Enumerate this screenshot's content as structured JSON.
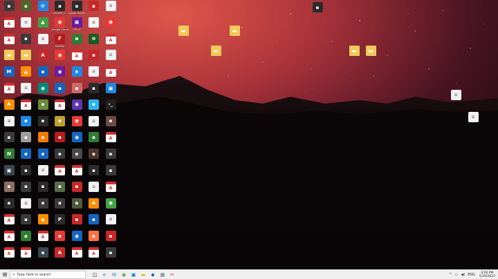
{
  "taskbar": {
    "search_placeholder": "Type here to search",
    "time": "4:00 PM",
    "date": "5/29/2023",
    "apps": [
      {
        "name": "task-view",
        "glyph": "◫",
        "color": "#333333"
      },
      {
        "name": "edge",
        "glyph": "e",
        "color": "#1e88e5"
      },
      {
        "name": "mail",
        "glyph": "✉",
        "color": "#0078d4"
      },
      {
        "name": "chrome",
        "glyph": "◉",
        "color": "#43a047"
      },
      {
        "name": "store",
        "glyph": "▣",
        "color": "#0078d4"
      },
      {
        "name": "file-explorer",
        "glyph": "▬",
        "color": "#e6b422"
      },
      {
        "name": "outlook",
        "glyph": "◆",
        "color": "#0064b4"
      },
      {
        "name": "photos",
        "glyph": "▦",
        "color": "#5a6b8a"
      },
      {
        "name": "snip",
        "glyph": "✂",
        "color": "#c62828"
      }
    ],
    "tray": [
      "^",
      "▭",
      "◀)",
      "ENG"
    ]
  },
  "desktop_icons": [
    {
      "label": "",
      "color": "#3a3a3a",
      "glyph": "▪"
    },
    {
      "label": "",
      "color": "#4a6a2a",
      "glyph": "▪"
    },
    {
      "label": "",
      "color": "#1e88e5",
      "glyph": "⟳"
    },
    {
      "label": "ureplaib_C...",
      "color": "#2b2b2b",
      "glyph": "▪"
    },
    {
      "label": "Adobe Notepad...",
      "color": "#2b2b2b",
      "glyph": "▪"
    },
    {
      "label": "...",
      "color": "#c62828",
      "glyph": "▪"
    },
    {
      "label": "",
      "color": "#ffffff",
      "glyph": "≡",
      "kind": "doc"
    },
    {
      "label": "",
      "color": "#ffffff",
      "glyph": "A",
      "kind": "pdf"
    },
    {
      "label": "",
      "color": "#ffffff",
      "glyph": "≡",
      "kind": "doc"
    },
    {
      "label": "",
      "color": "#43a047",
      "glyph": "▲"
    },
    {
      "label": "Google Chrome",
      "color": "#e53935",
      "glyph": "◉"
    },
    {
      "label": "CPU-Z",
      "color": "#6a1b9a",
      "glyph": "▣"
    },
    {
      "label": "",
      "color": "#ffffff",
      "glyph": "≡",
      "kind": "doc"
    },
    {
      "label": "",
      "color": "#e53935",
      "glyph": "◉"
    },
    {
      "label": "",
      "color": "#ffffff",
      "glyph": "A",
      "kind": "pdf"
    },
    {
      "label": "",
      "color": "#3a3a3a",
      "glyph": "▪"
    },
    {
      "label": "",
      "color": "#ffffff",
      "glyph": "≡",
      "kind": "doc"
    },
    {
      "label": "FileZilla",
      "color": "#b71c1c",
      "glyph": "F"
    },
    {
      "label": "",
      "color": "#2e7d32",
      "glyph": "▪"
    },
    {
      "label": "",
      "color": "#1b5e20",
      "glyph": "⊗"
    },
    {
      "label": "",
      "color": "#ffffff",
      "glyph": "A",
      "kind": "pdf"
    },
    {
      "label": "",
      "color": "#e0a030",
      "glyph": "▬",
      "kind": "folder"
    },
    {
      "label": "",
      "color": "#e0a030",
      "glyph": "▬",
      "kind": "folder"
    },
    {
      "label": "",
      "color": "#c62828",
      "glyph": "A"
    },
    {
      "label": "",
      "color": "#e53935",
      "glyph": "◉"
    },
    {
      "label": "",
      "color": "#ffffff",
      "glyph": "A",
      "kind": "pdf"
    },
    {
      "label": "",
      "color": "#c62828",
      "glyph": "▪"
    },
    {
      "label": "",
      "color": "#ffffff",
      "glyph": "≡",
      "kind": "doc"
    },
    {
      "label": "",
      "color": "#1565c0",
      "glyph": "M"
    },
    {
      "label": "",
      "color": "#ff8f00",
      "glyph": "▲"
    },
    {
      "label": "",
      "color": "#1565c0",
      "glyph": "▪"
    },
    {
      "label": "",
      "color": "#6a1b9a",
      "glyph": "◉"
    },
    {
      "label": "",
      "color": "#1e88e5",
      "glyph": "e"
    },
    {
      "label": "",
      "color": "#ffffff",
      "glyph": "≡",
      "kind": "doc"
    },
    {
      "label": "",
      "color": "#ffffff",
      "glyph": "A",
      "kind": "pdf"
    },
    {
      "label": "",
      "color": "#ffffff",
      "glyph": "A",
      "kind": "pdf"
    },
    {
      "label": "",
      "color": "#ffffff",
      "glyph": "≡",
      "kind": "doc"
    },
    {
      "label": "",
      "color": "#00897b",
      "glyph": "◉"
    },
    {
      "label": "",
      "color": "#1565c0",
      "glyph": "▪"
    },
    {
      "label": "",
      "color": "#c96b6b",
      "glyph": "▪"
    },
    {
      "label": "",
      "color": "#2b2b2b",
      "glyph": "▪"
    },
    {
      "label": "",
      "color": "#1e88e5",
      "glyph": "▣"
    },
    {
      "label": "",
      "color": "#ff8f00",
      "glyph": "A"
    },
    {
      "label": "",
      "color": "#ffffff",
      "glyph": "A",
      "kind": "pdf"
    },
    {
      "label": "",
      "color": "#6d8a3a",
      "glyph": "▪"
    },
    {
      "label": "",
      "color": "#ffffff",
      "glyph": "A",
      "kind": "pdf"
    },
    {
      "label": "",
      "color": "#5e35b1",
      "glyph": "◉"
    },
    {
      "label": "",
      "color": "#29b6f6",
      "glyph": "▪"
    },
    {
      "label": "",
      "color": "#212121",
      "glyph": "›_"
    },
    {
      "label": "",
      "color": "#ffffff",
      "glyph": "≡",
      "kind": "doc"
    },
    {
      "label": "",
      "color": "#1e88e5",
      "glyph": "▪"
    },
    {
      "label": "",
      "color": "#2b2b2b",
      "glyph": "▪"
    },
    {
      "label": "",
      "color": "#c0a030",
      "glyph": "▪"
    },
    {
      "label": "",
      "color": "#e53935",
      "glyph": "◉"
    },
    {
      "label": "",
      "color": "#ffffff",
      "glyph": "≡",
      "kind": "doc"
    },
    {
      "label": "",
      "color": "#6d4c41",
      "glyph": "▪"
    },
    {
      "label": "",
      "color": "#3a3a3a",
      "glyph": "▪"
    },
    {
      "label": "",
      "color": "#9e9e9e",
      "glyph": "▪"
    },
    {
      "label": "",
      "color": "#f57c00",
      "glyph": "▪"
    },
    {
      "label": "",
      "color": "#b71c1c",
      "glyph": "▪"
    },
    {
      "label": "",
      "color": "#1565c0",
      "glyph": "◉"
    },
    {
      "label": "",
      "color": "#2e7d32",
      "glyph": "▪"
    },
    {
      "label": "",
      "color": "#ffffff",
      "glyph": "A",
      "kind": "pdf"
    },
    {
      "label": "",
      "color": "#2e7d32",
      "glyph": "N"
    },
    {
      "label": "",
      "color": "#1565c0",
      "glyph": "▪"
    },
    {
      "label": "",
      "color": "#1565c0",
      "glyph": "▪"
    },
    {
      "label": "",
      "color": "#3a3a3a",
      "glyph": "▪"
    },
    {
      "label": "",
      "color": "#4a4a4a",
      "glyph": "▪"
    },
    {
      "label": "",
      "color": "#4e342e",
      "glyph": "▪"
    },
    {
      "label": "",
      "color": "#3a3a3a",
      "glyph": "▪"
    },
    {
      "label": "",
      "color": "#37474f",
      "glyph": "▣"
    },
    {
      "label": "",
      "color": "#2b2b2b",
      "glyph": "▪"
    },
    {
      "label": "",
      "color": "#ffffff",
      "glyph": "≡",
      "kind": "doc"
    },
    {
      "label": "",
      "color": "#ffffff",
      "glyph": "A",
      "kind": "pdf"
    },
    {
      "label": "",
      "color": "#ffffff",
      "glyph": "A",
      "kind": "pdf"
    },
    {
      "label": "",
      "color": "#2b2b2b",
      "glyph": "▪"
    },
    {
      "label": "",
      "color": "#3a3a3a",
      "glyph": "▪"
    },
    {
      "label": "",
      "color": "#8d6e63",
      "glyph": "▪"
    },
    {
      "label": "",
      "color": "#3a3a3a",
      "glyph": "▪"
    },
    {
      "label": "",
      "color": "#2b2b2b",
      "glyph": "▪"
    },
    {
      "label": "",
      "color": "#5a6b4a",
      "glyph": "▪"
    },
    {
      "label": "",
      "color": "#c62828",
      "glyph": "▪"
    },
    {
      "label": "",
      "color": "#ffffff",
      "glyph": "≡",
      "kind": "doc"
    },
    {
      "label": "",
      "color": "#ffffff",
      "glyph": "A",
      "kind": "pdf"
    },
    {
      "label": "",
      "color": "#2b2b2b",
      "glyph": "▪"
    },
    {
      "label": "",
      "color": "#ffffff",
      "glyph": "≡",
      "kind": "doc"
    },
    {
      "label": "",
      "color": "#3a3a3a",
      "glyph": "▪"
    },
    {
      "label": "",
      "color": "#3a3a3a",
      "glyph": "▪"
    },
    {
      "label": "",
      "color": "#4e5a3a",
      "glyph": "▪"
    },
    {
      "label": "",
      "color": "#ff8f00",
      "glyph": "A"
    },
    {
      "label": "",
      "color": "#43a047",
      "glyph": "◉"
    },
    {
      "label": "",
      "color": "#ffffff",
      "glyph": "A",
      "kind": "pdf"
    },
    {
      "label": "",
      "color": "#3a3a3a",
      "glyph": "▪"
    },
    {
      "label": "",
      "color": "#ff8f00",
      "glyph": "▪"
    },
    {
      "label": "",
      "color": "#2b2b2b",
      "glyph": "P"
    },
    {
      "label": "",
      "color": "#c62828",
      "glyph": "▪"
    },
    {
      "label": "",
      "color": "#1565c0",
      "glyph": "▪"
    },
    {
      "label": "",
      "color": "#ffffff",
      "glyph": "≡",
      "kind": "doc"
    },
    {
      "label": "",
      "color": "#ffffff",
      "glyph": "A",
      "kind": "pdf"
    },
    {
      "label": "",
      "color": "#2e7d32",
      "glyph": "▪"
    },
    {
      "label": "",
      "color": "#ffffff",
      "glyph": "A",
      "kind": "pdf"
    },
    {
      "label": "",
      "color": "#e53935",
      "glyph": "▪"
    },
    {
      "label": "",
      "color": "#1565c0",
      "glyph": "◉"
    },
    {
      "label": "",
      "color": "#ff7043",
      "glyph": "▪"
    },
    {
      "label": "",
      "color": "#c62828",
      "glyph": "▪"
    },
    {
      "label": "",
      "color": "#ffffff",
      "glyph": "A",
      "kind": "pdf"
    },
    {
      "label": "",
      "color": "#ffffff",
      "glyph": "A",
      "kind": "pdf"
    },
    {
      "label": "",
      "color": "#37474f",
      "glyph": "▪"
    },
    {
      "label": "",
      "color": "#c62828",
      "glyph": "A"
    },
    {
      "label": "",
      "color": "#ffffff",
      "glyph": "A",
      "kind": "pdf"
    },
    {
      "label": "",
      "color": "#ffffff",
      "glyph": "A",
      "kind": "pdf"
    },
    {
      "label": "",
      "color": "#3a3a3a",
      "glyph": "▪"
    }
  ],
  "right_icons": [
    {
      "label": "",
      "color": "#2b2b2b",
      "glyph": "▪"
    },
    {
      "label": "",
      "color": "#e0a030",
      "glyph": "▬",
      "kind": "folder"
    },
    {
      "label": "",
      "color": "#e0a030",
      "glyph": "▬",
      "kind": "folder"
    },
    {
      "label": "",
      "color": "#e0a030",
      "glyph": "▬",
      "kind": "folder"
    },
    {
      "label": "",
      "color": "#e0a030",
      "glyph": "▬",
      "kind": "folder"
    },
    {
      "label": "",
      "color": "#e0a030",
      "glyph": "▬",
      "kind": "folder"
    },
    {
      "label": "",
      "color": "#ffffff",
      "glyph": "≡",
      "kind": "doc"
    },
    {
      "label": "",
      "color": "#ffffff",
      "glyph": "≡",
      "kind": "doc"
    }
  ]
}
